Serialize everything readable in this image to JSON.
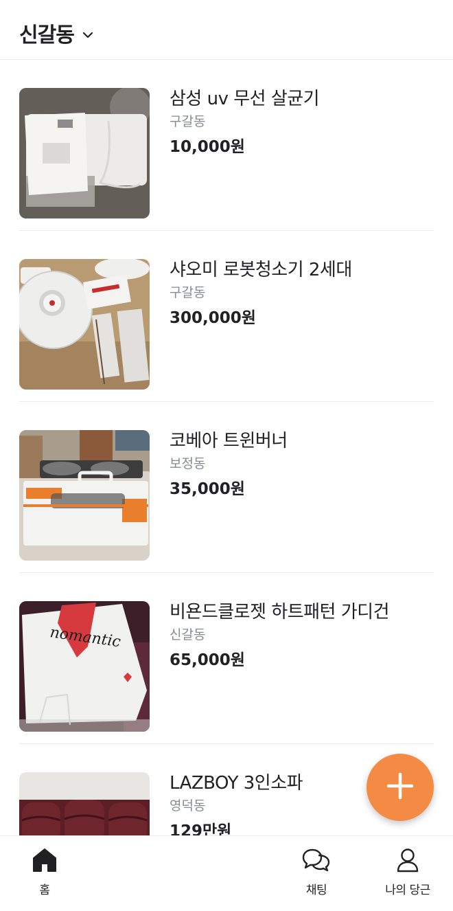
{
  "header": {
    "location": "신갈동"
  },
  "products": [
    {
      "title": "삼성 uv 무선 살균기",
      "region": "구갈동",
      "price": "10,000원"
    },
    {
      "title": "샤오미 로봇청소기 2세대",
      "region": "구갈동",
      "price": "300,000원"
    },
    {
      "title": "코베아 트윈버너",
      "region": "보정동",
      "price": "35,000원"
    },
    {
      "title": "비욘드클로젯 하트패턴 가디건",
      "region": "신갈동",
      "price": "65,000원",
      "thumb_text": "nomantic"
    },
    {
      "title": "LAZBOY 3인소파",
      "region": "영덕동",
      "price": "129만원"
    }
  ],
  "tabbar": {
    "home": "홈",
    "chat": "채팅",
    "my": "나의 당근"
  },
  "colors": {
    "accent": "#f38b45",
    "muted": "#868b94",
    "divider": "#e9ecef"
  },
  "icons": [
    "chevron-down-icon",
    "plus-icon",
    "home-icon",
    "chat-icon",
    "person-icon"
  ]
}
